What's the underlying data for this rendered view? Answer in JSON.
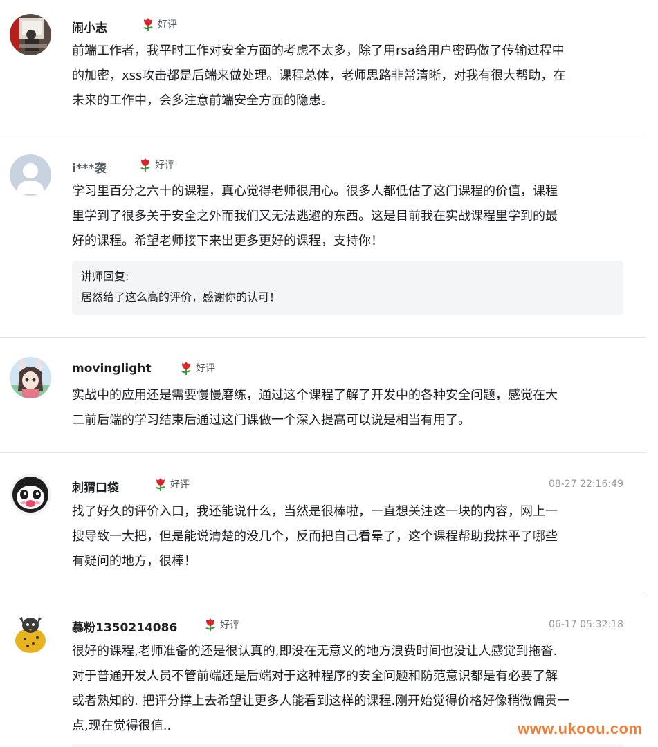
{
  "reviews": [
    {
      "user": "闹小志",
      "rating": "好评",
      "time": "",
      "lines": [
        "前端工作者，我平时工作对安全方面的考虑不太多，除了用rsa给用户密码做了传输过程中",
        "的加密，xss攻击都是后端来做处理。课程总体，老师思路非常清晰，对我有很大帮助，在",
        "未来的工作中，会多注意前端安全方面的隐患。"
      ]
    },
    {
      "user": "i***袭",
      "rating": "好评",
      "time": "",
      "lines": [
        "学习里百分之六十的课程，真心觉得老师很用心。很多人都低估了这门课程的价值，课程",
        "里学到了很多关于安全之外而我们又无法逃避的东西。这是目前我在实战课程里学到的最",
        "好的课程。希望老师接下来出更多更好的课程，支持你！"
      ],
      "reply": {
        "label": "讲师回复:",
        "text": "居然给了这么高的评价，感谢你的认可！"
      }
    },
    {
      "user": "movinglight",
      "rating": "好评",
      "time": "",
      "lines": [
        "实战中的应用还是需要慢慢磨练，通过这个课程了解了开发中的各种安全问题，感觉在大",
        "二前后端的学习结束后通过这门课做一个深入提高可以说是相当有用了。"
      ]
    },
    {
      "user": "刺猬口袋",
      "rating": "好评",
      "time": "08-27 22:16:49",
      "lines": [
        "找了好久的评价入口，我还能说什么，当然是很棒啦，一直想关注这一块的内容，网上一",
        "搜导致一大把，但是能说清楚的没几个，反而把自己看晕了，这个课程帮助我抹平了哪些",
        "有疑问的地方，很棒！"
      ]
    },
    {
      "user": "慕粉1350214086",
      "rating": "好评",
      "time": "06-17 05:32:18",
      "lines": [
        "很好的课程,老师准备的还是很认真的,即没在无意义的地方浪费时间也没让人感觉到拖沓.",
        "对于普通开发人员不管前端还是后端对于这种程序的安全问题和防范意识都是有必要了解",
        "或者熟知的. 把评分撑上去希望让更多人能看到这样的课程.刚开始觉得价格好像稍微偏贵一",
        "点,现在觉得很值.."
      ]
    }
  ],
  "watermark": "www.ukoou.com",
  "colors": {
    "rose": "#d9252b",
    "leaf": "#3a9a3a",
    "watermark": "#ef7e38",
    "reply_bg": "#f3f5f6"
  },
  "icons": [
    "rose-icon",
    "user-avatar",
    "default-avatar-icon"
  ]
}
